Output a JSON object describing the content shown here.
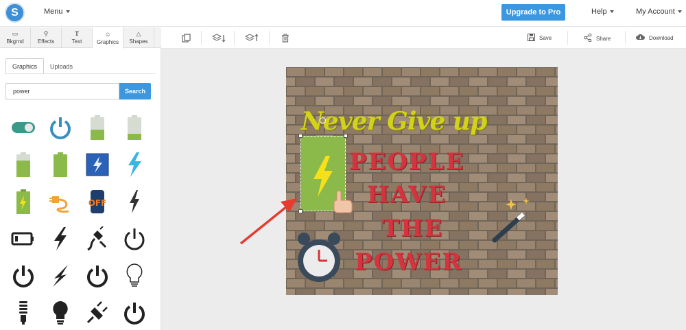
{
  "header": {
    "logo_letter": "S",
    "menu_label": "Menu",
    "upgrade_label": "Upgrade to Pro",
    "help_label": "Help",
    "account_label": "My Account"
  },
  "sidebar": {
    "categories": [
      {
        "label": "Bkgrnd",
        "icon": "image-icon"
      },
      {
        "label": "Effects",
        "icon": "wand-icon"
      },
      {
        "label": "Text",
        "icon": "text-icon"
      },
      {
        "label": "Graphics",
        "icon": "smiley-icon"
      },
      {
        "label": "Shapes",
        "icon": "triangle-icon"
      }
    ],
    "active_category": "Graphics",
    "sub_tabs": [
      "Graphics",
      "Uploads"
    ],
    "active_sub_tab": "Graphics",
    "search_value": "power",
    "search_button": "Search",
    "gallery": [
      "toggle-switch-icon",
      "power-ring-icon",
      "battery-full-icon",
      "battery-low-icon",
      "battery-green-icon",
      "battery-green-2-icon",
      "bolt-blue-tile-icon",
      "bolt-cyan-icon",
      "battery-charging-icon",
      "plug-orange-icon",
      "off-button-icon",
      "bolt-black-icon",
      "battery-outline-icon",
      "bolt-black-2-icon",
      "plug-unplugged-icon",
      "power-symbol-icon",
      "power-symbol-bold-icon",
      "bolt-thin-icon",
      "power-symbol-2-icon",
      "lightbulb-outline-icon",
      "cfl-bulb-icon",
      "lightbulb-filled-icon",
      "plug-icon",
      "power-symbol-3-icon"
    ]
  },
  "toolbar": {
    "save_label": "Save",
    "share_label": "Share",
    "download_label": "Download"
  },
  "canvas": {
    "headline": "Never Give up",
    "lines": [
      "PEOPLE",
      "HAVE",
      "THE",
      "POWER"
    ]
  },
  "colors": {
    "accent": "#3b97e0",
    "headline": "#d2d21a",
    "lines": "#d3343e",
    "battery": "#8bb94a",
    "bolt": "#f5e11a"
  }
}
